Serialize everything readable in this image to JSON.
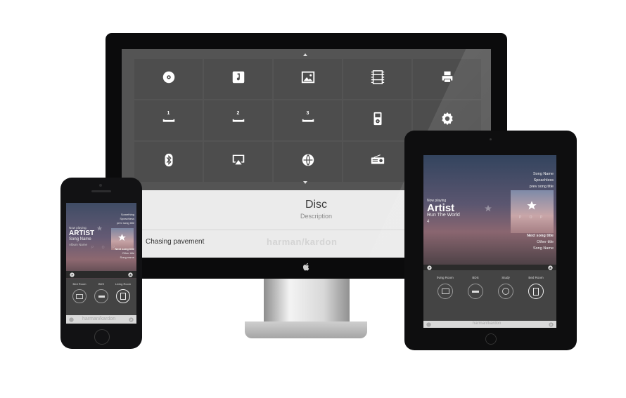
{
  "monitor": {
    "tiles": [
      {
        "icon": "disc-icon"
      },
      {
        "icon": "music-note-icon"
      },
      {
        "icon": "image-icon"
      },
      {
        "icon": "film-icon"
      },
      {
        "icon": "printer-icon"
      },
      {
        "icon": "input-1-icon",
        "label": "1"
      },
      {
        "icon": "input-2-icon",
        "label": "2"
      },
      {
        "icon": "input-3-icon",
        "label": "3"
      },
      {
        "icon": "ipod-icon"
      },
      {
        "icon": "gear-icon"
      },
      {
        "icon": "bluetooth-icon"
      },
      {
        "icon": "airplay-icon"
      },
      {
        "icon": "network-icon"
      },
      {
        "icon": "radio-icon"
      }
    ],
    "panel": {
      "title": "Disc",
      "description": "Description",
      "track": "Chasing pavement",
      "brand": "harman/kardon"
    }
  },
  "tablet": {
    "now_playing_label": "Now playing",
    "artist": "Artist",
    "album": "Run The World",
    "track_number": "4",
    "upcoming": [
      "Song Name",
      "Speachless",
      "prev song title"
    ],
    "next": [
      "Next song title",
      "Other title",
      "Song Name"
    ],
    "cover_text": "P O P",
    "rooms": [
      {
        "label": "living Room",
        "icon": "monitor-icon"
      },
      {
        "label": "BDS",
        "icon": "disc-player-icon"
      },
      {
        "label": "Study",
        "icon": "speaker-icon"
      },
      {
        "label": "Bed Room",
        "icon": "dock-icon"
      }
    ],
    "brand": "harman/kardon"
  },
  "phone": {
    "now_playing_label": "Now playing:",
    "artist": "ARTIST",
    "song": "Song Name",
    "album": "Album Name",
    "upcoming": [
      "Something",
      "Speachless",
      "prev song title"
    ],
    "next": [
      "Next song title",
      "Other title",
      "Song name"
    ],
    "cover_text": "P O P",
    "rooms": [
      {
        "label": "Bed Room",
        "icon": "monitor-icon"
      },
      {
        "label": "BDS",
        "icon": "disc-player-icon"
      },
      {
        "label": "Living Room",
        "icon": "dock-icon"
      }
    ],
    "brand": "harman/kardon"
  },
  "colors": {
    "tile": "#4d4d4d",
    "screen_bg": "#545454",
    "panel": "#ebebeb"
  }
}
